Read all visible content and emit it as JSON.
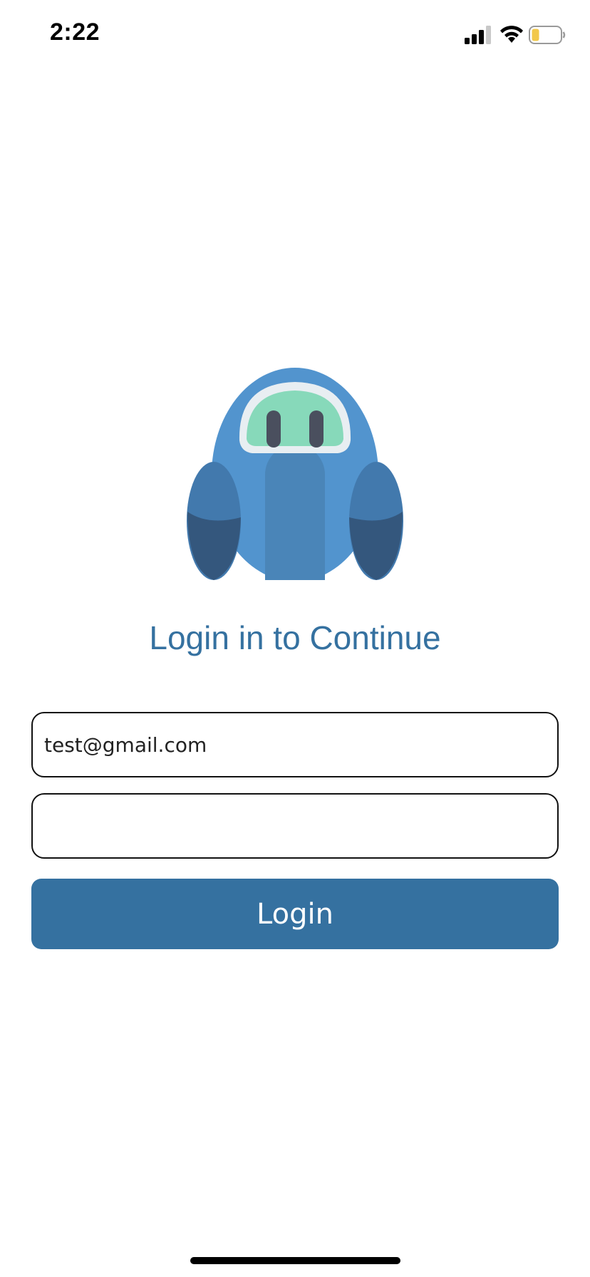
{
  "status_bar": {
    "time": "2:22",
    "icons": [
      "signal-icon",
      "wifi-icon",
      "battery-icon"
    ],
    "battery_color": "#f2c84b"
  },
  "mascot": {
    "icon": "robot-mascot-icon",
    "colors": {
      "body": "#5294ce",
      "body_dark": "#4a85b8",
      "arm": "#4279ad",
      "arm_shadow": "#34577d",
      "visor_ring": "#e8eef2",
      "visor": "#87d9ba",
      "eyes": "#4a4f5e"
    }
  },
  "login": {
    "title": "Login in to Continue",
    "email_value": "test@gmail.com",
    "password_value": "",
    "button_label": "Login",
    "accent_color": "#3571a0"
  }
}
